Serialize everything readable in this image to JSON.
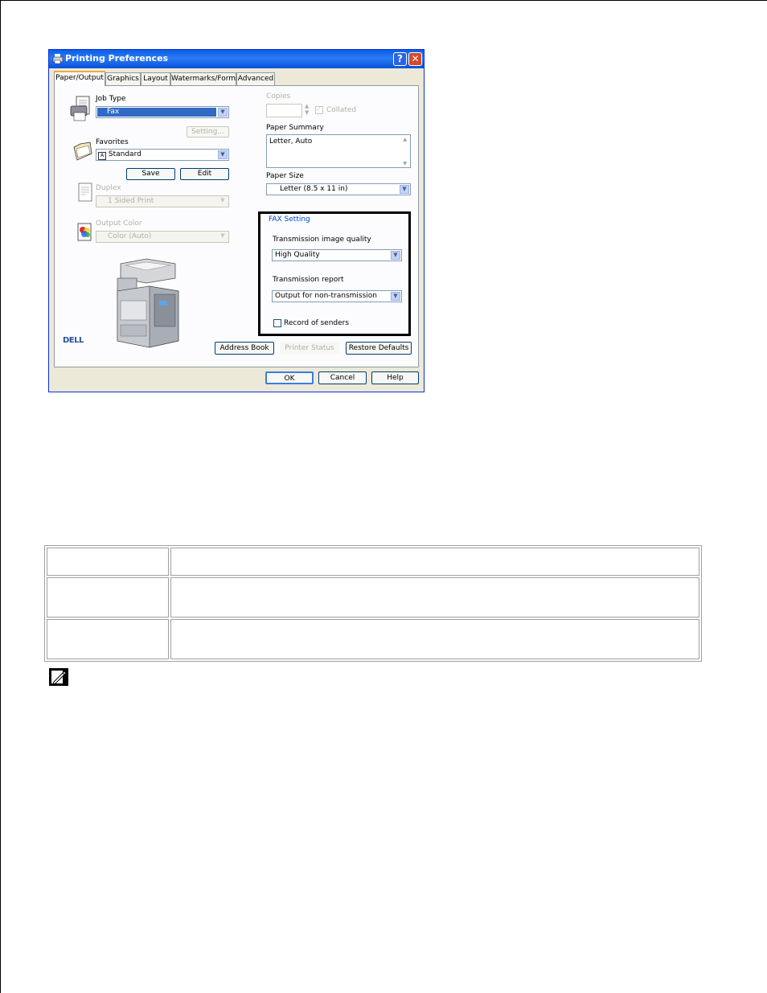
{
  "dialog": {
    "title": "Printing Preferences",
    "tabs": [
      "Paper/Output",
      "Graphics",
      "Layout",
      "Watermarks/Forms",
      "Advanced"
    ],
    "job_type": {
      "label": "Job Type",
      "value": "Fax",
      "setting_button": "Setting..."
    },
    "favorites": {
      "label": "Favorites",
      "value": "Standard",
      "save_button": "Save",
      "edit_button": "Edit"
    },
    "duplex": {
      "label": "Duplex",
      "value": "1 Sided Print"
    },
    "output_color": {
      "label": "Output Color",
      "value": "Color (Auto)"
    },
    "copies": {
      "label": "Copies",
      "collated_label": "Collated"
    },
    "paper_summary": {
      "label": "Paper Summary",
      "value": "Letter, Auto"
    },
    "paper_size": {
      "label": "Paper Size",
      "value": "Letter (8.5 x 11 in)"
    },
    "fax_setting": {
      "label": "FAX Setting",
      "image_quality_label": "Transmission image quality",
      "image_quality_value": "High Quality",
      "report_label": "Transmission report",
      "report_value": "Output for non-transmission",
      "record_label": "Record of senders"
    },
    "brand": "DELL",
    "address_book_button": "Address Book",
    "printer_status_button": "Printer Status",
    "restore_defaults_button": "Restore Defaults",
    "ok_button": "OK",
    "cancel_button": "Cancel",
    "help_button": "Help"
  },
  "table": {
    "rows": [
      [
        "",
        ""
      ],
      [
        "",
        ""
      ],
      [
        "",
        ""
      ]
    ]
  },
  "colors": {
    "titlebar": "#0a5ee8",
    "highlight": "#316ac5",
    "window_face": "#ece9d8"
  }
}
